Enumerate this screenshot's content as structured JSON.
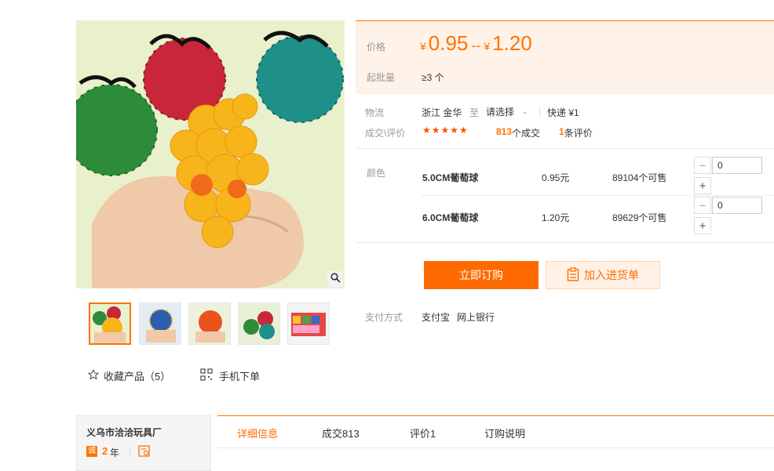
{
  "gallery": {
    "thumbnails": [
      "thumb-1",
      "thumb-2",
      "thumb-3",
      "thumb-4",
      "thumb-5"
    ],
    "favorite_label": "收藏产品（5）",
    "mobile_order_label": "手机下单"
  },
  "price": {
    "label": "价格",
    "currency": "¥",
    "low": "0.95",
    "separator": "--",
    "high": "1.20",
    "moq_label": "起批量",
    "moq_value": "≥3 个"
  },
  "logistics": {
    "label": "物流",
    "origin": "浙江 金华",
    "to": "至",
    "destination": "请选择",
    "shipping": "快递 ¥1"
  },
  "trade": {
    "label": "成交\\评价",
    "stars": "★★★★★",
    "deals_count": "813",
    "deals_suffix": "个成交",
    "reviews_count": "1",
    "reviews_suffix": "条评价"
  },
  "variants": {
    "label": "颜色",
    "items": [
      {
        "name": "5.0CM葡萄球",
        "price": "0.95元",
        "stock": "89104个可售",
        "qty": "0"
      },
      {
        "name": "6.0CM葡萄球",
        "price": "1.20元",
        "stock": "89629个可售",
        "qty": "0"
      }
    ]
  },
  "actions": {
    "buy_now": "立即订购",
    "add_to_cart": "加入进货单"
  },
  "payment": {
    "label": "支付方式",
    "methods": [
      "支付宝",
      "网上银行"
    ]
  },
  "shop": {
    "name": "义乌市洽洽玩具厂",
    "badge": "诚",
    "years": "2",
    "years_suffix": "年"
  },
  "tabs": [
    "详细信息",
    "成交813",
    "评价1",
    "订购说明"
  ],
  "colors": {
    "accent": "#ff6a00",
    "price_bg": "#fff2e8"
  }
}
